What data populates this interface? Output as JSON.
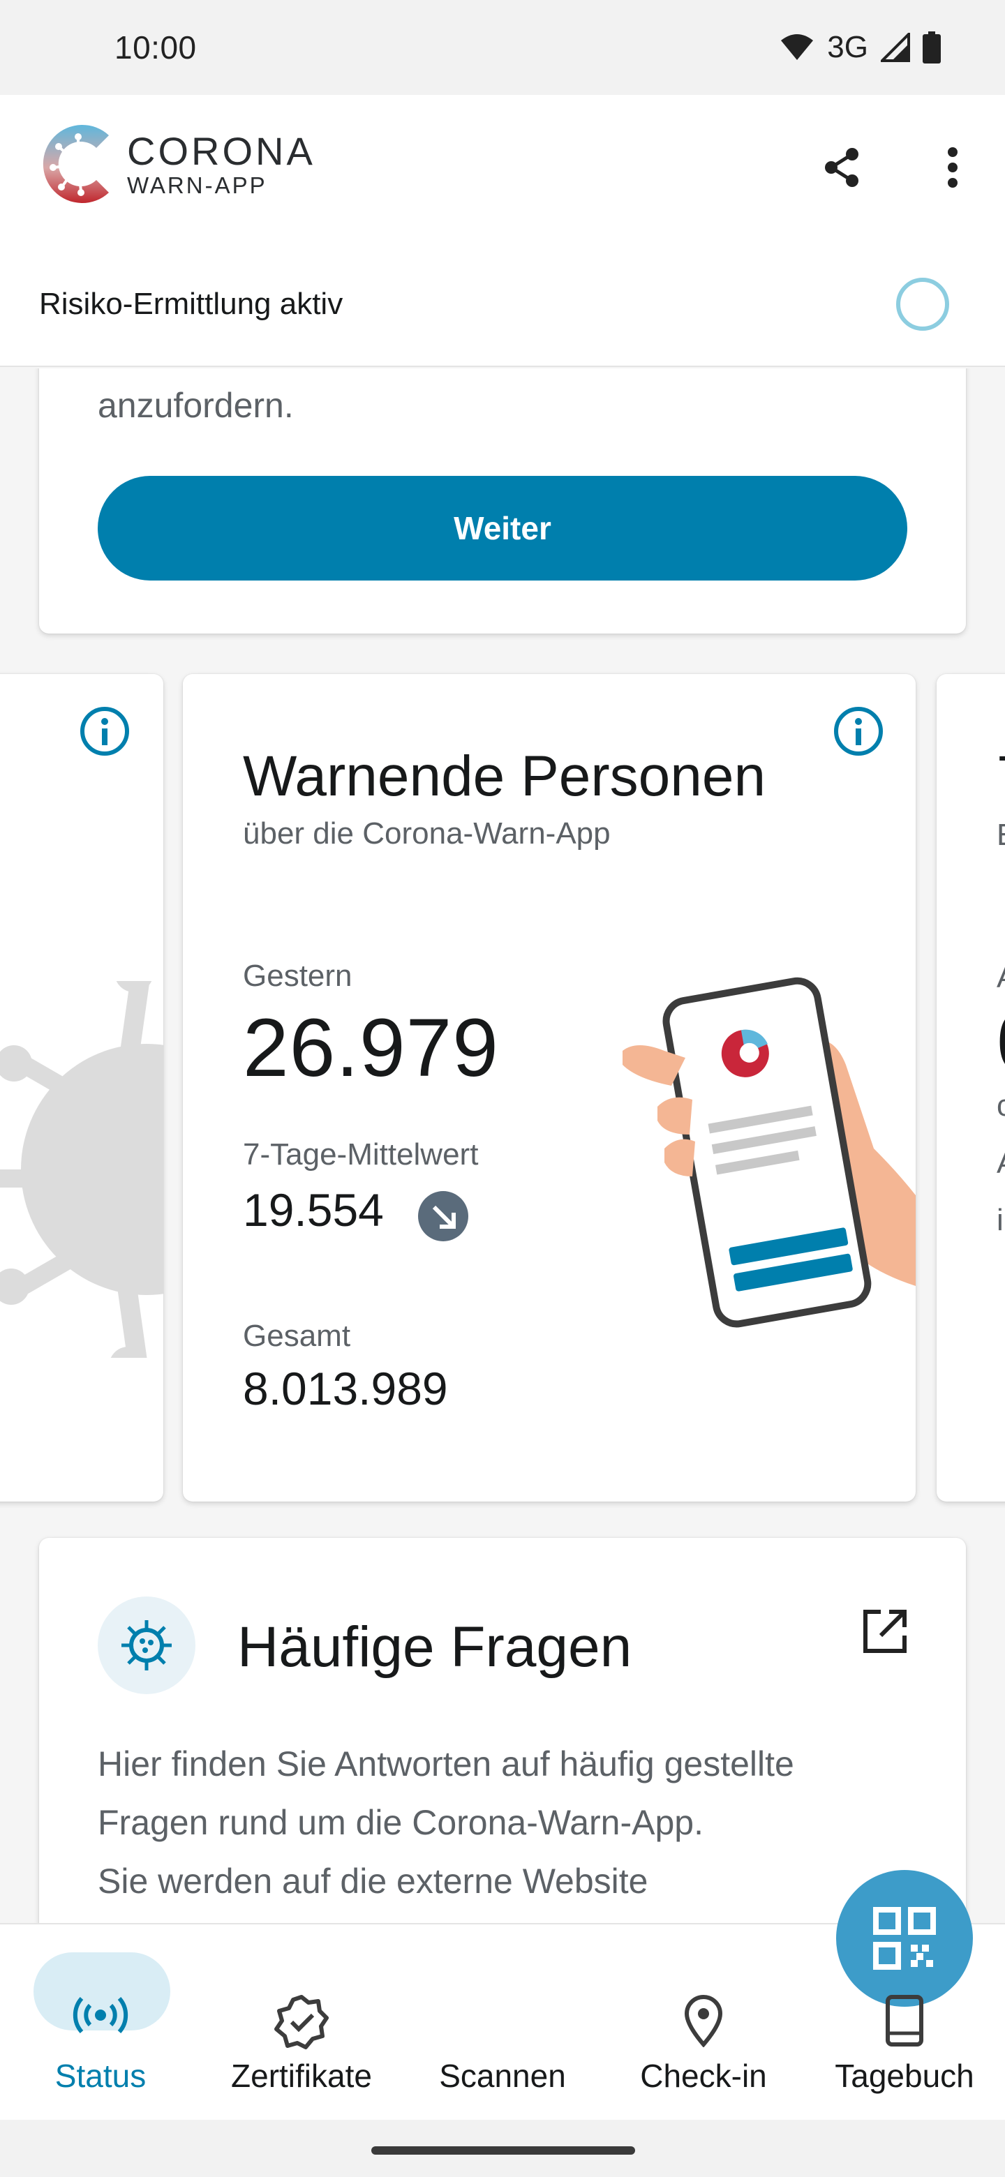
{
  "status_bar": {
    "time": "10:00",
    "network": "3G"
  },
  "app": {
    "logo_line1": "CORONA",
    "logo_line2": "WARN-APP",
    "risk_status": "Risiko-Ermittlung aktiv"
  },
  "test_card": {
    "tail_text": "anzufordern.",
    "button_label": "Weiter"
  },
  "stat_card": {
    "title": "Warnende Personen",
    "subtitle": "über die Corona-Warn-App",
    "yesterday_label": "Gestern",
    "yesterday_value": "26.979",
    "avg_label": "7-Tage-Mittelwert",
    "avg_value": "19.554",
    "trend": "down",
    "total_label": "Gesamt",
    "total_value": "8.013.989"
  },
  "next_card_peek": {
    "title_char": "7",
    "sub_char": "E",
    "label_char": "A",
    "value_char": "0",
    "line1": "c",
    "line2": "A",
    "line3": "i"
  },
  "faq_card": {
    "title": "Häufige Fragen",
    "body_lines": [
      "Hier finden Sie Antworten auf häufig gestellte",
      "Fragen rund um die Corona-Warn-App.",
      "Sie werden auf die externe Website"
    ]
  },
  "bottom_nav": {
    "items": [
      {
        "label": "Status",
        "icon": "radar-icon",
        "active": true
      },
      {
        "label": "Zertifikate",
        "icon": "certificate-icon",
        "active": false
      },
      {
        "label": "Scannen",
        "icon": "qr-code-icon",
        "active": false
      },
      {
        "label": "Check-in",
        "icon": "location-pin-icon",
        "active": false
      },
      {
        "label": "Tagebuch",
        "icon": "book-icon",
        "active": false
      }
    ]
  },
  "colors": {
    "primary": "#007fad",
    "active_pill": "#d9edf5",
    "fab": "#3d9cc9",
    "trend_badge": "#5a6b7b"
  }
}
